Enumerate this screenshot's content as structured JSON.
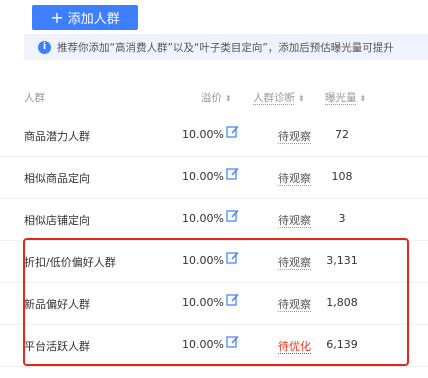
{
  "add_button": {
    "plus": "+",
    "label": "添加人群"
  },
  "notice": {
    "icon": "info-icon",
    "text": "推荐你添加“高消费人群”以及“叶子类目定向”，添加后预估曝光量可提升"
  },
  "table": {
    "columns": {
      "crowd": "人群",
      "premium": "溢价",
      "diagnosis": "人群诊断",
      "exposure": "曝光量"
    },
    "rows": [
      {
        "crowd": "商品潜力人群",
        "premium": "10.00%",
        "diagnosis": "待观察",
        "exposure": "72",
        "warn": false
      },
      {
        "crowd": "相似商品定向",
        "premium": "10.00%",
        "diagnosis": "待观察",
        "exposure": "108",
        "warn": false
      },
      {
        "crowd": "相似店铺定向",
        "premium": "10.00%",
        "diagnosis": "待观察",
        "exposure": "3",
        "warn": false
      },
      {
        "crowd": "折扣/低价偏好人群",
        "premium": "10.00%",
        "diagnosis": "待观察",
        "exposure": "3,131",
        "warn": false
      },
      {
        "crowd": "新品偏好人群",
        "premium": "10.00%",
        "diagnosis": "待观察",
        "exposure": "1,808",
        "warn": false
      },
      {
        "crowd": "平台活跃人群",
        "premium": "10.00%",
        "diagnosis": "待优化",
        "exposure": "6,139",
        "warn": true
      }
    ]
  },
  "colors": {
    "accent": "#3d7fff",
    "warn": "#e8341c",
    "highlight": "#e8231c"
  }
}
